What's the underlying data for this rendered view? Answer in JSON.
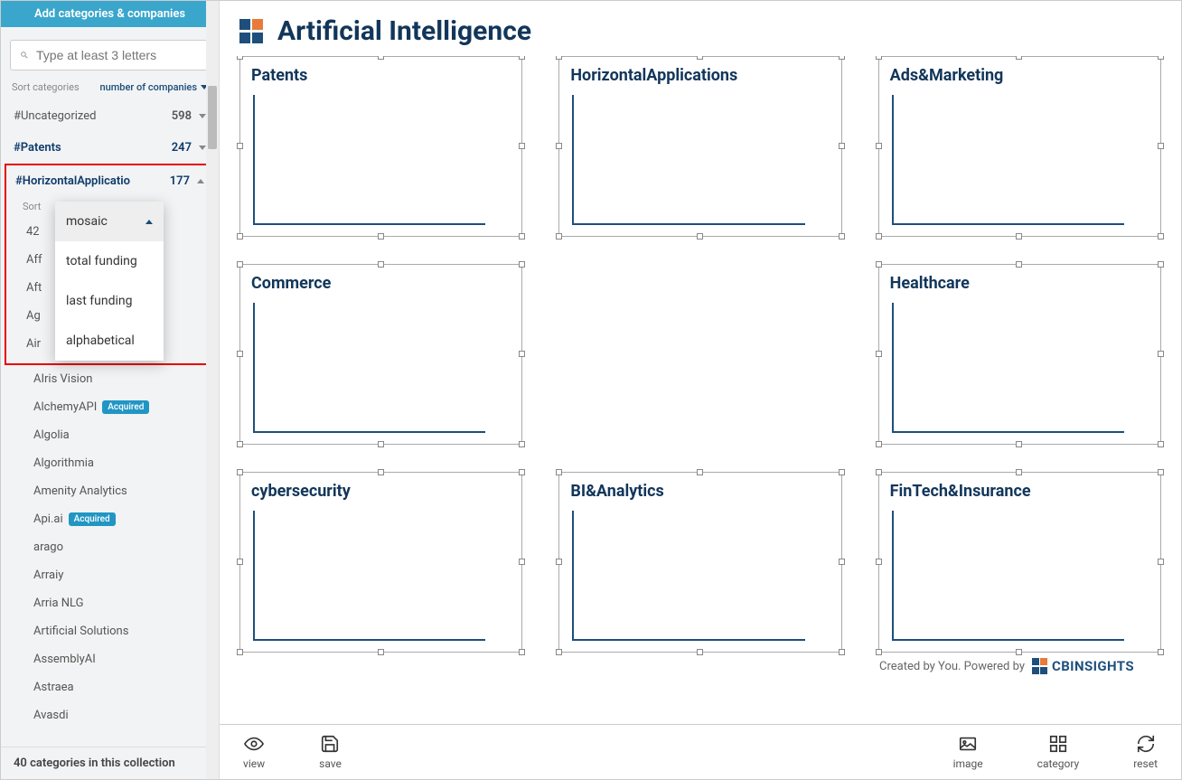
{
  "sidebar": {
    "header": "Add categories & companies",
    "search_placeholder": "Type at least 3 letters",
    "sort_label": "Sort categories",
    "sort_value": "number of companies",
    "categories": [
      {
        "name": "#Uncategorized",
        "count": "598",
        "expanded": false,
        "active": false
      },
      {
        "name": "#Patents",
        "count": "247",
        "expanded": false,
        "active": true
      },
      {
        "name": "#HorizontalApplicatio",
        "count": "177",
        "expanded": true,
        "active": true
      }
    ],
    "sub_sort_label": "Sort",
    "companies_partial": [
      "42",
      "Aff",
      "Aft",
      "Ag",
      "Air"
    ],
    "companies_rest": [
      {
        "name": "AIris Vision",
        "badge": null
      },
      {
        "name": "AlchemyAPI",
        "badge": "Acquired"
      },
      {
        "name": "Algolia",
        "badge": null
      },
      {
        "name": "Algorithmia",
        "badge": null
      },
      {
        "name": "Amenity Analytics",
        "badge": null
      },
      {
        "name": "Api.ai",
        "badge": "Acquired"
      },
      {
        "name": "arago",
        "badge": null
      },
      {
        "name": "Arraiy",
        "badge": null
      },
      {
        "name": "Arria NLG",
        "badge": null
      },
      {
        "name": "Artificial Solutions",
        "badge": null
      },
      {
        "name": "AssemblyAI",
        "badge": null
      },
      {
        "name": "Astraea",
        "badge": null
      },
      {
        "name": "Avasdi",
        "badge": null
      }
    ],
    "footer": "40 categories in this collection"
  },
  "dropdown": {
    "items": [
      "mosaic",
      "total funding",
      "last funding",
      "alphabetical"
    ],
    "selected": 0
  },
  "canvas": {
    "title": "Artificial Intelligence",
    "cards": [
      "Patents",
      "HorizontalApplications",
      "Ads&Marketing",
      "Commerce",
      "",
      "Healthcare",
      "cybersecurity",
      "BI&Analytics",
      "FinTech&Insurance"
    ],
    "attribution": "Created by You. Powered by",
    "brand": "CBINSIGHTS"
  },
  "toolbar": {
    "view": "view",
    "save": "save",
    "image": "image",
    "category": "category",
    "reset": "reset"
  }
}
